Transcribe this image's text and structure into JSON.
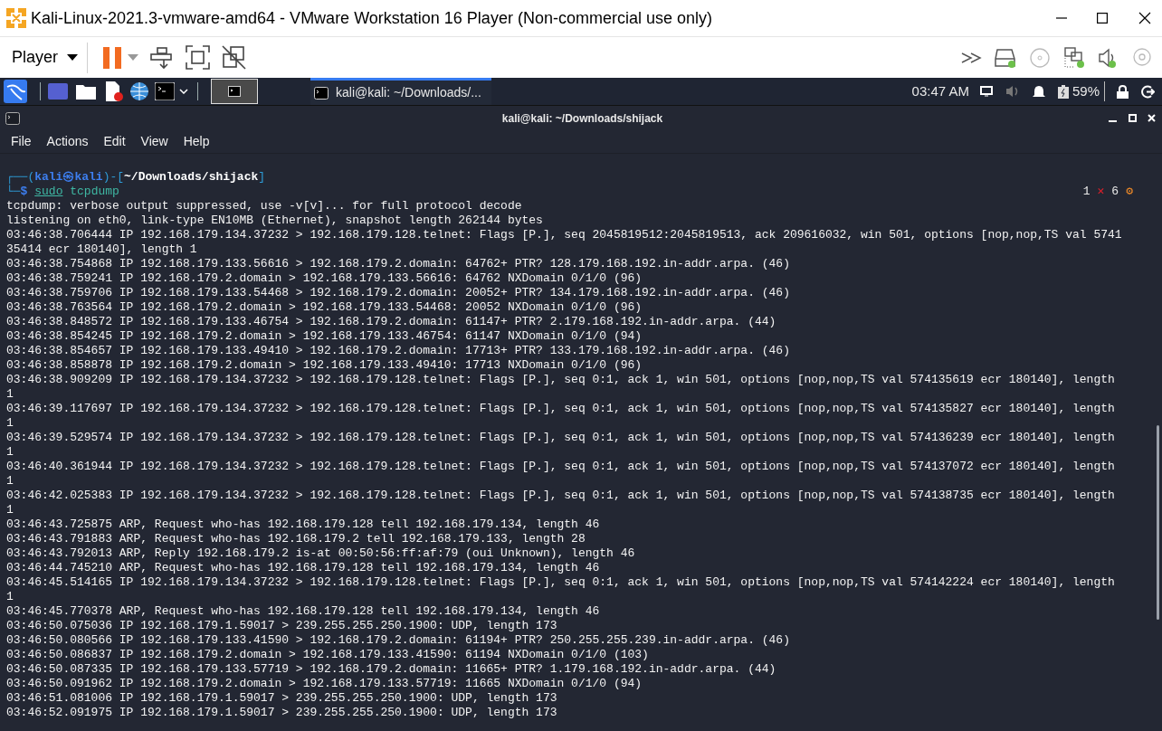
{
  "window": {
    "title": "Kali-Linux-2021.3-vmware-amd64 - VMware Workstation 16 Player (Non-commercial use only)"
  },
  "toolbar": {
    "menu": "Player"
  },
  "panel": {
    "task": "kali@kali: ~/Downloads/...",
    "time": "03:47 AM",
    "battery": "59%"
  },
  "terminal": {
    "title": "kali@kali: ~/Downloads/shijack",
    "menu": [
      "File",
      "Actions",
      "Edit",
      "View",
      "Help"
    ],
    "prompt": {
      "open": "┌──(",
      "user": "kali㉿kali",
      "mid": ")-[",
      "path": "~/Downloads/shijack",
      "close": "]",
      "corner": "└─",
      "sign": "$",
      "command": "sudo",
      "args": "tcpdump"
    },
    "status": [
      "1",
      "✕",
      "6",
      "⚙"
    ],
    "output": [
      "tcpdump: verbose output suppressed, use -v[v]... for full protocol decode",
      "listening on eth0, link-type EN10MB (Ethernet), snapshot length 262144 bytes",
      "03:46:38.706444 IP 192.168.179.134.37232 > 192.168.179.128.telnet: Flags [P.], seq 2045819512:2045819513, ack 209616032, win 501, options [nop,nop,TS val 574135414 ecr 180140], length 1",
      "03:46:38.754868 IP 192.168.179.133.56616 > 192.168.179.2.domain: 64762+ PTR? 128.179.168.192.in-addr.arpa. (46)",
      "03:46:38.759241 IP 192.168.179.2.domain > 192.168.179.133.56616: 64762 NXDomain 0/1/0 (96)",
      "03:46:38.759706 IP 192.168.179.133.54468 > 192.168.179.2.domain: 20052+ PTR? 134.179.168.192.in-addr.arpa. (46)",
      "03:46:38.763564 IP 192.168.179.2.domain > 192.168.179.133.54468: 20052 NXDomain 0/1/0 (96)",
      "03:46:38.848572 IP 192.168.179.133.46754 > 192.168.179.2.domain: 61147+ PTR? 2.179.168.192.in-addr.arpa. (44)",
      "03:46:38.854245 IP 192.168.179.2.domain > 192.168.179.133.46754: 61147 NXDomain 0/1/0 (94)",
      "03:46:38.854657 IP 192.168.179.133.49410 > 192.168.179.2.domain: 17713+ PTR? 133.179.168.192.in-addr.arpa. (46)",
      "03:46:38.858878 IP 192.168.179.2.domain > 192.168.179.133.49410: 17713 NXDomain 0/1/0 (96)",
      "03:46:38.909209 IP 192.168.179.134.37232 > 192.168.179.128.telnet: Flags [P.], seq 0:1, ack 1, win 501, options [nop,nop,TS val 574135619 ecr 180140], length 1",
      "03:46:39.117697 IP 192.168.179.134.37232 > 192.168.179.128.telnet: Flags [P.], seq 0:1, ack 1, win 501, options [nop,nop,TS val 574135827 ecr 180140], length 1",
      "03:46:39.529574 IP 192.168.179.134.37232 > 192.168.179.128.telnet: Flags [P.], seq 0:1, ack 1, win 501, options [nop,nop,TS val 574136239 ecr 180140], length 1",
      "03:46:40.361944 IP 192.168.179.134.37232 > 192.168.179.128.telnet: Flags [P.], seq 0:1, ack 1, win 501, options [nop,nop,TS val 574137072 ecr 180140], length 1",
      "03:46:42.025383 IP 192.168.179.134.37232 > 192.168.179.128.telnet: Flags [P.], seq 0:1, ack 1, win 501, options [nop,nop,TS val 574138735 ecr 180140], length 1",
      "03:46:43.725875 ARP, Request who-has 192.168.179.128 tell 192.168.179.134, length 46",
      "03:46:43.791883 ARP, Request who-has 192.168.179.2 tell 192.168.179.133, length 28",
      "03:46:43.792013 ARP, Reply 192.168.179.2 is-at 00:50:56:ff:af:79 (oui Unknown), length 46",
      "03:46:44.745210 ARP, Request who-has 192.168.179.128 tell 192.168.179.134, length 46",
      "03:46:45.514165 IP 192.168.179.134.37232 > 192.168.179.128.telnet: Flags [P.], seq 0:1, ack 1, win 501, options [nop,nop,TS val 574142224 ecr 180140], length 1",
      "03:46:45.770378 ARP, Request who-has 192.168.179.128 tell 192.168.179.134, length 46",
      "03:46:50.075036 IP 192.168.179.1.59017 > 239.255.255.250.1900: UDP, length 173",
      "03:46:50.080566 IP 192.168.179.133.41590 > 192.168.179.2.domain: 61194+ PTR? 250.255.255.239.in-addr.arpa. (46)",
      "03:46:50.086837 IP 192.168.179.2.domain > 192.168.179.133.41590: 61194 NXDomain 0/1/0 (103)",
      "03:46:50.087335 IP 192.168.179.133.57719 > 192.168.179.2.domain: 11665+ PTR? 1.179.168.192.in-addr.arpa. (44)",
      "03:46:50.091962 IP 192.168.179.2.domain > 192.168.179.133.57719: 11665 NXDomain 0/1/0 (94)",
      "03:46:51.081006 IP 192.168.179.1.59017 > 239.255.255.250.1900: UDP, length 173",
      "03:46:52.091975 IP 192.168.179.1.59017 > 239.255.255.250.1900: UDP, length 173"
    ]
  }
}
